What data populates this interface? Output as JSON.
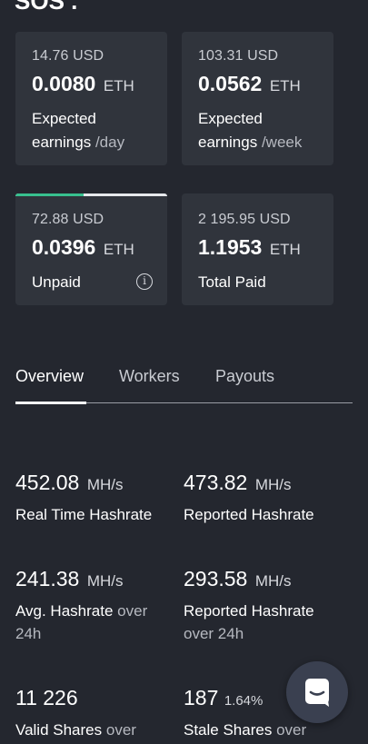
{
  "header": {
    "cut_text": "SOS ."
  },
  "cards": {
    "day": {
      "usd": "14.76 USD",
      "eth": "0.0080",
      "unit": "ETH",
      "label": "Expected",
      "label2": "earnings",
      "per": "/day"
    },
    "week": {
      "usd": "103.31 USD",
      "eth": "0.0562",
      "unit": "ETH",
      "label": "Expected",
      "label2": "earnings",
      "per": "/week"
    },
    "unpaid": {
      "usd": "72.88 USD",
      "eth": "0.0396",
      "unit": "ETH",
      "label": "Unpaid",
      "progress": 0.45,
      "info_icon": "info-icon"
    },
    "paid": {
      "usd": "2 195.95 USD",
      "eth": "1.1953",
      "unit": "ETH",
      "label": "Total Paid"
    }
  },
  "tabs": [
    {
      "label": "Overview",
      "active": true
    },
    {
      "label": "Workers",
      "active": false
    },
    {
      "label": "Payouts",
      "active": false
    }
  ],
  "stats": {
    "realtime": {
      "value": "452.08",
      "unit": "MH/s",
      "label": "Real Time Hashrate"
    },
    "reported": {
      "value": "473.82",
      "unit": "MH/s",
      "label": "Reported Hashrate"
    },
    "avg": {
      "value": "241.38",
      "unit": "MH/s",
      "label": "Avg. Hashrate",
      "label_muted": "over",
      "label_line2": "24h"
    },
    "reported24": {
      "value": "293.58",
      "unit": "MH/s",
      "label": "Reported Hashrate",
      "label_line2": "over 24h"
    },
    "valid": {
      "value": "11 226",
      "label": "Valid Shares",
      "label_muted": "over"
    },
    "stale": {
      "value": "187",
      "pct": "1.64%",
      "label": "Stale Shares",
      "label_muted": "over"
    }
  },
  "chat": {
    "icon": "chat-icon"
  },
  "colors": {
    "background": "#24272f",
    "card": "#30343c",
    "accent": "#38c08f"
  }
}
